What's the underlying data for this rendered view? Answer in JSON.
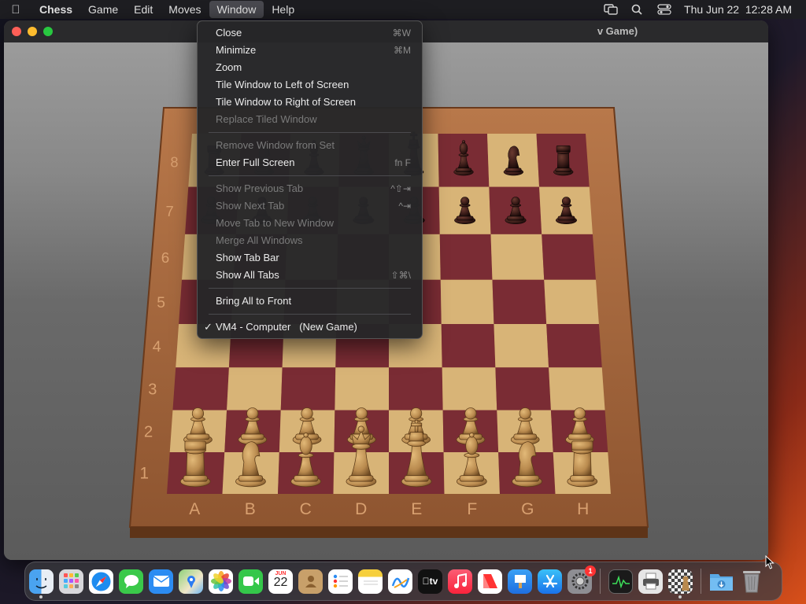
{
  "menubar": {
    "app_name": "Chess",
    "items": [
      "Game",
      "Edit",
      "Moves",
      "Window",
      "Help"
    ],
    "active_item": "Window",
    "datetime": "Thu Jun 22  12:28 AM"
  },
  "window": {
    "title_visible": "v Game)"
  },
  "window_menu": {
    "items": [
      {
        "label": "Close",
        "shortcut": "⌘W",
        "enabled": true
      },
      {
        "label": "Minimize",
        "shortcut": "⌘M",
        "enabled": true
      },
      {
        "label": "Zoom",
        "shortcut": "",
        "enabled": true
      },
      {
        "label": "Tile Window to Left of Screen",
        "shortcut": "",
        "enabled": true
      },
      {
        "label": "Tile Window to Right of Screen",
        "shortcut": "",
        "enabled": true
      },
      {
        "label": "Replace Tiled Window",
        "shortcut": "",
        "enabled": false
      },
      {
        "label": "Remove Window from Set",
        "shortcut": "",
        "enabled": false
      },
      {
        "label": "Enter Full Screen",
        "shortcut": "fn F",
        "enabled": true
      },
      {
        "label": "Show Previous Tab",
        "shortcut": "^⇧⇥",
        "enabled": false
      },
      {
        "label": "Show Next Tab",
        "shortcut": "^⇥",
        "enabled": false
      },
      {
        "label": "Move Tab to New Window",
        "shortcut": "",
        "enabled": false
      },
      {
        "label": "Merge All Windows",
        "shortcut": "",
        "enabled": false
      },
      {
        "label": "Show Tab Bar",
        "shortcut": "",
        "enabled": true
      },
      {
        "label": "Show All Tabs",
        "shortcut": "⇧⌘\\",
        "enabled": true
      },
      {
        "label": "Bring All to Front",
        "shortcut": "",
        "enabled": true
      },
      {
        "label": "VM4 - Computer   (New Game)",
        "shortcut": "",
        "enabled": true,
        "checked": true,
        "check_mark": "✓"
      }
    ]
  },
  "board": {
    "rank_labels": [
      "8",
      "7",
      "6",
      "5",
      "4",
      "3",
      "2",
      "1"
    ],
    "file_labels": [
      "A",
      "B",
      "C",
      "D",
      "E",
      "F",
      "G",
      "H"
    ],
    "colors": {
      "frame": "#a8663a",
      "light_square": "#d8b477",
      "dark_square": "#7a2c34",
      "white_piece": "#b98a4e",
      "black_piece": "#3a1c18"
    }
  },
  "dock": {
    "calendar_month": "JUN",
    "calendar_day": "22",
    "appletv_label": "tv",
    "settings_badge": "1",
    "icons": [
      "finder-icon",
      "launchpad-icon",
      "safari-icon",
      "messages-icon",
      "mail-icon",
      "maps-icon",
      "photos-icon",
      "facetime-icon",
      "calendar-icon",
      "contacts-icon",
      "reminders-icon",
      "notes-icon",
      "freeform-icon",
      "appletv-icon",
      "music-icon",
      "news-icon",
      "keynote-icon",
      "appstore-icon",
      "settings-icon",
      "activity-monitor-icon",
      "printer-icon",
      "chess-icon",
      "downloads-folder-icon",
      "trash-icon"
    ]
  }
}
